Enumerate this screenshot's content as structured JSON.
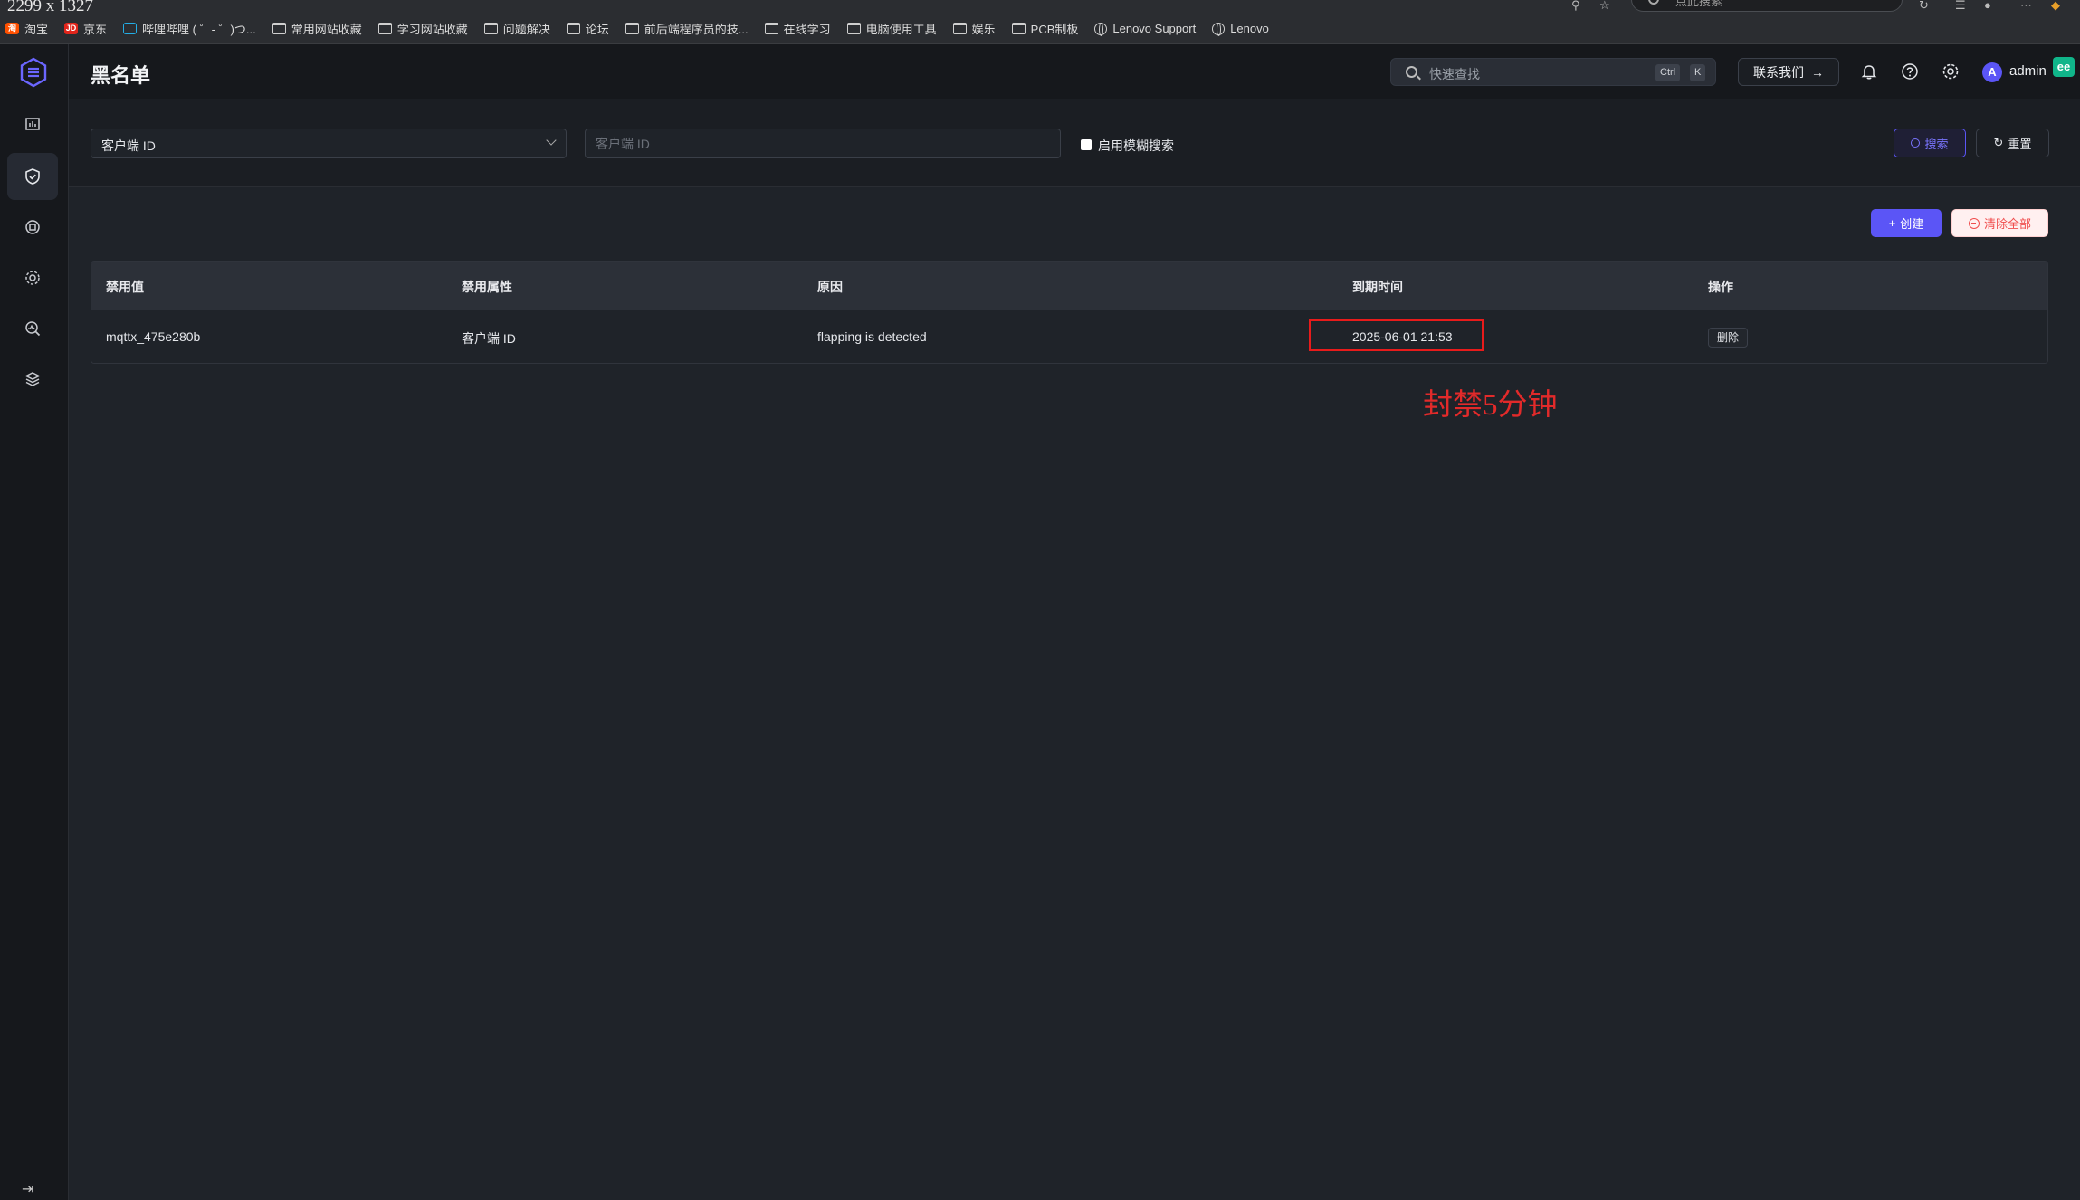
{
  "browser": {
    "size_readout": "2299 x 1327",
    "search_placeholder": "点此搜索",
    "bookmarks": [
      {
        "label": "淘宝",
        "icon": "taobao-icon"
      },
      {
        "label": "京东",
        "icon": "jd-icon"
      },
      {
        "label": "哔哩哔哩 ( ゜- ゜)つ...",
        "icon": "bilibili-icon"
      },
      {
        "label": "常用网站收藏",
        "icon": "folder-icon"
      },
      {
        "label": "学习网站收藏",
        "icon": "folder-icon"
      },
      {
        "label": "问题解决",
        "icon": "folder-icon"
      },
      {
        "label": "论坛",
        "icon": "folder-icon"
      },
      {
        "label": "前后端程序员的技...",
        "icon": "folder-icon"
      },
      {
        "label": "在线学习",
        "icon": "folder-icon"
      },
      {
        "label": "电脑使用工具",
        "icon": "folder-icon"
      },
      {
        "label": "娱乐",
        "icon": "folder-icon"
      },
      {
        "label": "PCB制板",
        "icon": "folder-icon"
      },
      {
        "label": "Lenovo Support",
        "icon": "globe-icon"
      },
      {
        "label": "Lenovo",
        "icon": "globe-icon"
      }
    ]
  },
  "header": {
    "title": "黑名单",
    "search_placeholder": "快速查找",
    "kbd_ctrl": "Ctrl",
    "kbd_k": "K",
    "contact_label": "联系我们",
    "avatar_letter": "A",
    "username": "admin",
    "ext_badge": "ee"
  },
  "filter": {
    "select_value": "客户端 ID",
    "input_placeholder": "客户端 ID",
    "fuzzy_label": "启用模糊搜索",
    "search_label": "搜索",
    "reset_label": "重置"
  },
  "actions": {
    "create_label": "创建",
    "clear_label": "清除全部"
  },
  "table": {
    "columns": [
      "禁用值",
      "禁用属性",
      "原因",
      "到期时间",
      "操作"
    ],
    "rows": [
      {
        "value": "mqttx_475e280b",
        "attribute": "客户端 ID",
        "reason": "flapping is detected",
        "expire": "2025-06-01 21:53",
        "action": "删除"
      }
    ]
  },
  "annotation": "封禁5分钟",
  "colors": {
    "accent": "#5b55f6",
    "danger": "#f04d4d",
    "highlight": "#e81b1b"
  }
}
